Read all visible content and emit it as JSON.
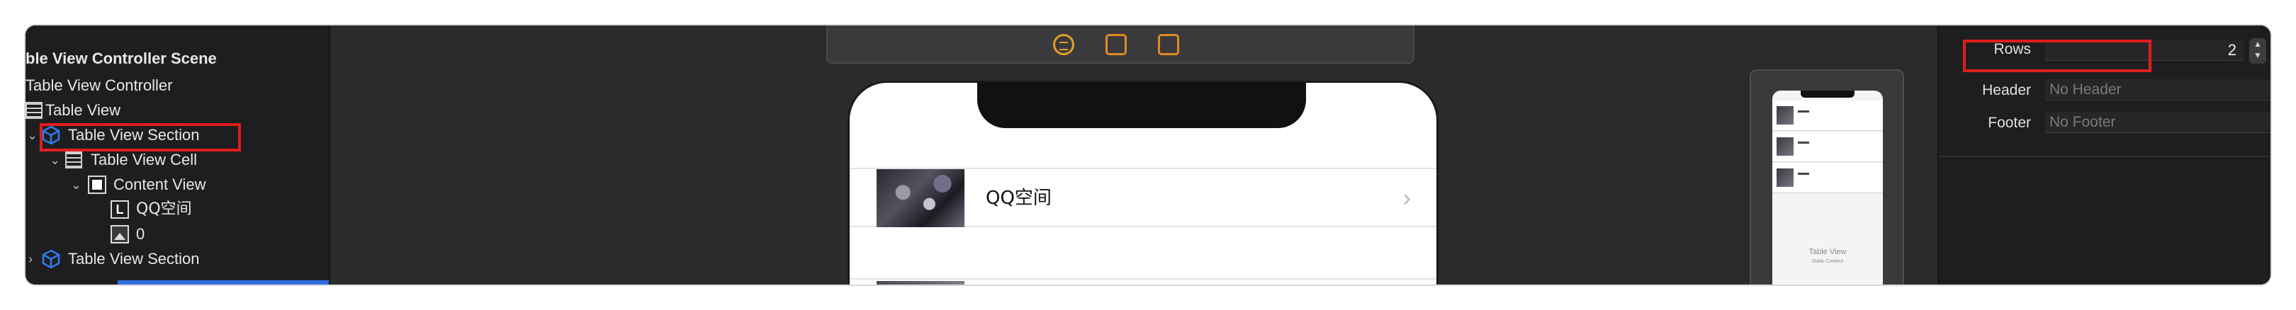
{
  "navigator": {
    "scene_title": "ble View Controller Scene",
    "items": [
      {
        "label": "Table View Controller"
      },
      {
        "label": "Table View"
      },
      {
        "label": "Table View Section"
      },
      {
        "label": "Table View Cell"
      },
      {
        "label": "Content View"
      },
      {
        "label": "QQ空间"
      },
      {
        "label": "0"
      },
      {
        "label": "Table View Section"
      }
    ]
  },
  "canvas": {
    "cell_title": "QQ空间",
    "cell_accessory": "›",
    "minimap": {
      "table_label": "Table View",
      "table_sublabel": "Static Content"
    }
  },
  "inspector": {
    "rows_label": "Rows",
    "rows_value": "2",
    "header_label": "Header",
    "header_placeholder": "No Header",
    "footer_label": "Footer",
    "footer_placeholder": "No Footer"
  },
  "colors": {
    "highlight": "#e21d1d",
    "accent_blue": "#2d6cdf",
    "scene_icon": "#e0a024"
  }
}
